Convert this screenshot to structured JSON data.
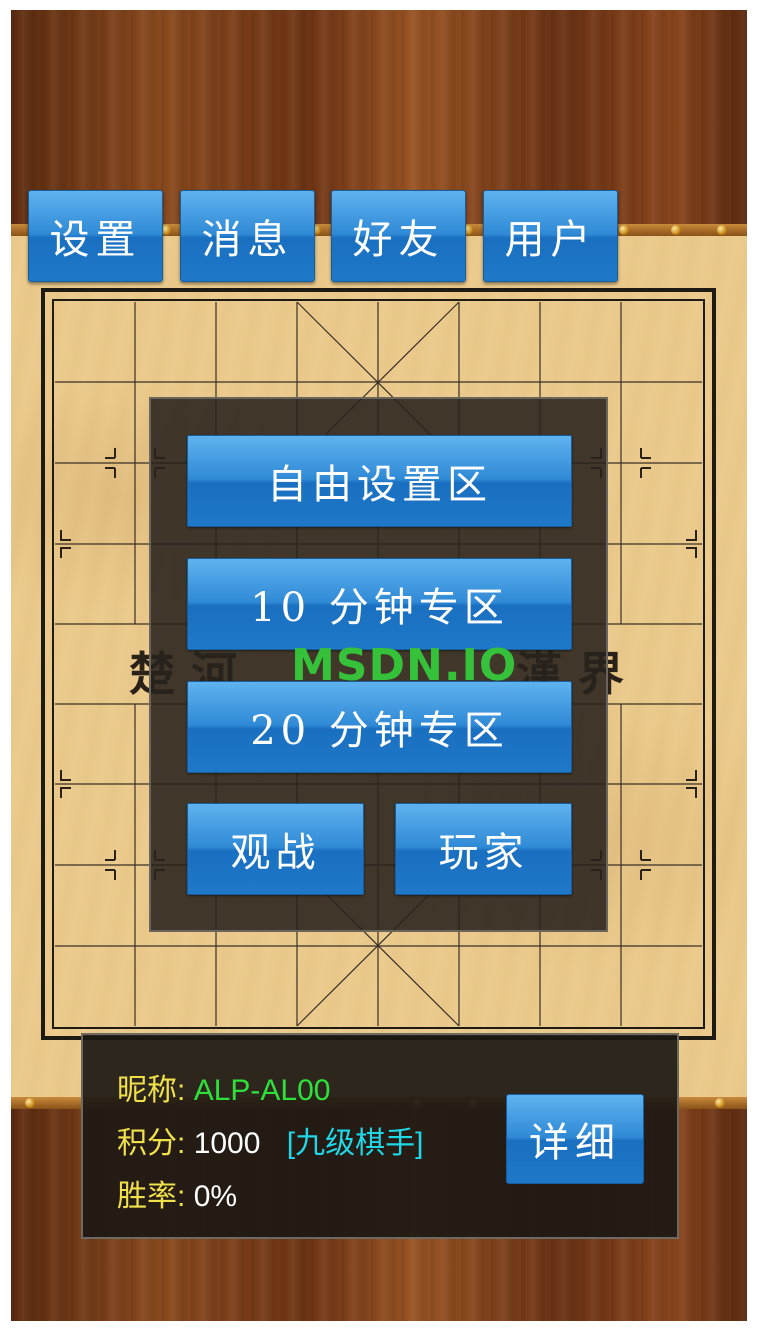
{
  "nav": {
    "settings": "设置",
    "messages": "消息",
    "friends": "好友",
    "user": "用户"
  },
  "board": {
    "river_left": "楚河",
    "river_right": "漢界"
  },
  "menu": {
    "free_zone": "自由设置区",
    "ten_min_zone": "10 分钟专区",
    "twenty_min_zone": "20 分钟专区",
    "watch": "观战",
    "players": "玩家"
  },
  "watermark": "MSDN.IO",
  "profile": {
    "nickname_label": "昵称:",
    "nickname": "ALP-AL00",
    "score_label": "积分:",
    "score": "1000",
    "rank": "[九级棋手]",
    "winrate_label": "胜率:",
    "winrate": "0%",
    "detail_button": "详细"
  },
  "colors": {
    "button_blue": "#2f8ad6",
    "label_yellow": "#f0e04a",
    "nickname_green": "#2ee03a",
    "rank_cyan": "#1fd7e6"
  }
}
